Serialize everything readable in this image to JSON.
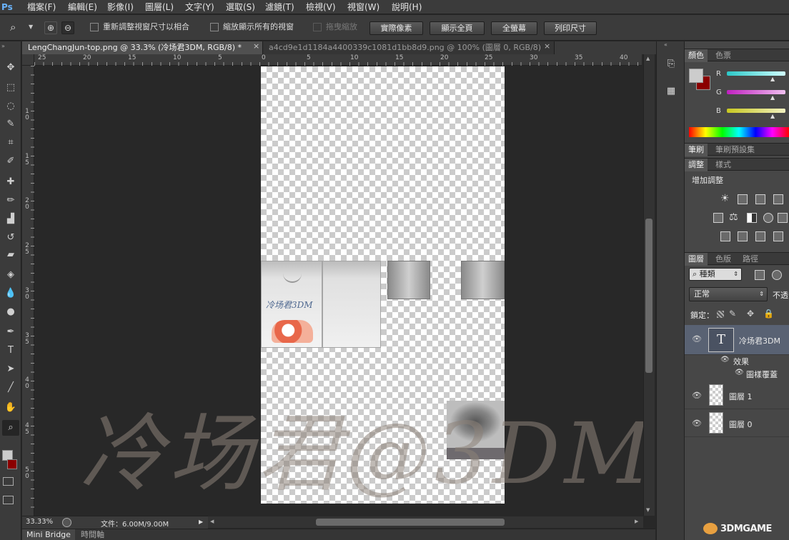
{
  "app": {
    "logo": "Ps"
  },
  "menu": [
    "檔案(F)",
    "編輯(E)",
    "影像(I)",
    "圖層(L)",
    "文字(Y)",
    "選取(S)",
    "濾鏡(T)",
    "檢視(V)",
    "視窗(W)",
    "說明(H)"
  ],
  "options": {
    "resize_window_label": "重新調整視窗尺寸以相合",
    "zoom_all_windows_label": "縮放顯示所有的視窗",
    "scrubby_zoom_label": "拖曳縮放",
    "actual_pixels": "實際像素",
    "fit_screen": "顯示全頁",
    "fill_screen": "全螢幕",
    "print_size": "列印尺寸"
  },
  "tabs": [
    {
      "label": "LengChangJun-top.png @ 33.3% (冷场君3DM, RGB/8) *",
      "close": "×"
    },
    {
      "label": "a4cd9e1d1184a4400339c1081d1bb8d9.png @ 100% (圖層 0, RGB/8)",
      "close": "×"
    }
  ],
  "ruler_h": [
    "25",
    "20",
    "15",
    "10",
    "5",
    "0",
    "5",
    "10",
    "15",
    "20",
    "25",
    "30",
    "35",
    "40"
  ],
  "ruler_v": [
    "1",
    "0",
    "1",
    "5",
    "2",
    "0",
    "2",
    "5",
    "3",
    "0",
    "3",
    "5",
    "4",
    "0",
    "4",
    "5",
    "5",
    "0"
  ],
  "status": {
    "zoom": "33.33%",
    "doc_size": "文件：6.00M/9.00M"
  },
  "bottom_tabs": [
    "Mini Bridge",
    "時間軸"
  ],
  "color_panel": {
    "tabs": [
      "顏色",
      "色票"
    ],
    "channels": [
      "R",
      "G",
      "B"
    ],
    "foreground": "#cccccc",
    "background": "#8b0000"
  },
  "brush_panel": {
    "tabs": [
      "筆刷",
      "筆刷預設集"
    ]
  },
  "adjust_panel": {
    "tabs": [
      "調整",
      "樣式"
    ],
    "title": "增加調整"
  },
  "layers_panel": {
    "tabs": [
      "圖層",
      "色版",
      "路徑"
    ],
    "filter_label": "種類",
    "blend_mode": "正常",
    "opacity_label": "不透",
    "lock_label": "鎖定：",
    "text_layer_glyph": "T",
    "layers": [
      {
        "name": "冷场君3DM",
        "type": "text",
        "effects_label": "效果",
        "effect": "圖樣覆蓋"
      },
      {
        "name": "圖層 1",
        "type": "raster"
      },
      {
        "name": "圖層 0",
        "type": "raster"
      }
    ]
  },
  "canvas": {
    "shirt_logo": "冷场君3DM"
  },
  "watermark": {
    "text": "冷场君@3DM",
    "corner": "3DMGAME"
  }
}
